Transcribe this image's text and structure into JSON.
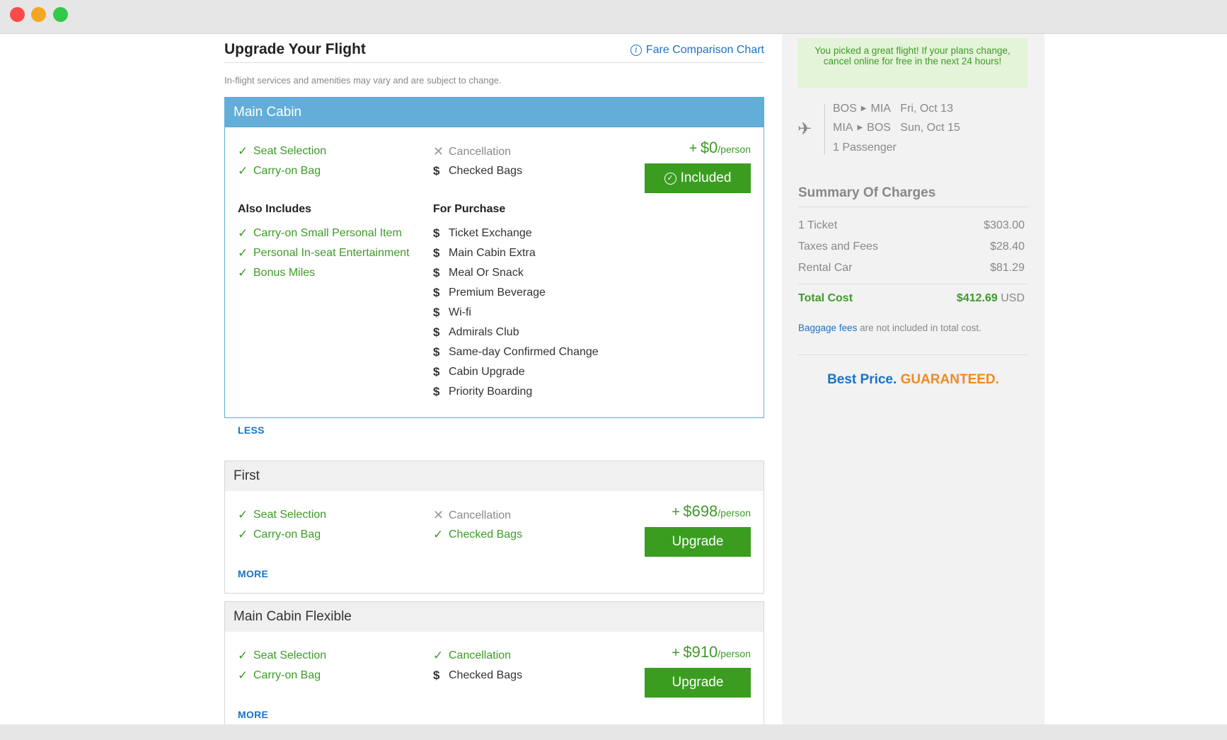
{
  "page": {
    "title": "Upgrade Your Flight",
    "fare_comparison_link": "Fare Comparison Chart",
    "subtitle": "In-flight services and amenities may vary and are subject to change."
  },
  "cards": [
    {
      "name": "Main Cabin",
      "features_left": [
        {
          "label": "Seat Selection",
          "status": "included",
          "icon": "check-icon"
        },
        {
          "label": "Carry-on Bag",
          "status": "included",
          "icon": "check-icon"
        }
      ],
      "features_right": [
        {
          "label": "Cancellation",
          "status": "unavailable",
          "icon": "x-icon"
        },
        {
          "label": "Checked Bags",
          "status": "purchase",
          "icon": "dollar-icon"
        }
      ],
      "price_plus": "+",
      "price": "$0",
      "price_unit": "/person",
      "button_label": "Included",
      "also_includes_heading": "Also Includes",
      "also_includes": [
        "Carry-on Small Personal Item",
        "Personal In-seat Entertainment",
        "Bonus Miles"
      ],
      "for_purchase_heading": "For Purchase",
      "for_purchase": [
        "Ticket Exchange",
        "Main Cabin Extra",
        "Meal Or Snack",
        "Premium Beverage",
        "Wi-fi",
        "Admirals Club",
        "Same-day Confirmed Change",
        "Cabin Upgrade",
        "Priority Boarding"
      ],
      "toggle_label": "LESS"
    },
    {
      "name": "First",
      "features_left": [
        {
          "label": "Seat Selection",
          "status": "included",
          "icon": "check-icon"
        },
        {
          "label": "Carry-on Bag",
          "status": "included",
          "icon": "check-icon"
        }
      ],
      "features_right": [
        {
          "label": "Cancellation",
          "status": "unavailable",
          "icon": "x-icon"
        },
        {
          "label": "Checked Bags",
          "status": "included",
          "icon": "check-icon"
        }
      ],
      "price_plus": "+",
      "price": "$698",
      "price_unit": "/person",
      "button_label": "Upgrade",
      "toggle_label": "MORE"
    },
    {
      "name": "Main Cabin Flexible",
      "features_left": [
        {
          "label": "Seat Selection",
          "status": "included",
          "icon": "check-icon"
        },
        {
          "label": "Carry-on Bag",
          "status": "included",
          "icon": "check-icon"
        }
      ],
      "features_right": [
        {
          "label": "Cancellation",
          "status": "included",
          "icon": "check-icon"
        },
        {
          "label": "Checked Bags",
          "status": "purchase",
          "icon": "dollar-icon"
        }
      ],
      "price_plus": "+",
      "price": "$910",
      "price_unit": "/person",
      "button_label": "Upgrade",
      "toggle_label": "MORE"
    }
  ],
  "sidebar": {
    "notice": "You picked a great flight! If your plans change, cancel online for free in the next 24 hours!",
    "itinerary": [
      {
        "from": "BOS",
        "to": "MIA",
        "date": "Fri, Oct 13"
      },
      {
        "from": "MIA",
        "to": "BOS",
        "date": "Sun, Oct 15"
      }
    ],
    "passengers": "1 Passenger",
    "summary_title": "Summary Of Charges",
    "charges": [
      {
        "label": "1 Ticket",
        "amount": "$303.00"
      },
      {
        "label": "Taxes and Fees",
        "amount": "$28.40"
      },
      {
        "label": "Rental Car",
        "amount": "$81.29"
      }
    ],
    "total_label": "Total Cost",
    "total_amount": "$412.69",
    "total_currency": "USD",
    "baggage_link": "Baggage fees",
    "baggage_note": " are not included in total cost.",
    "guarantee_best": "Best Price.",
    "guarantee_word": "GUARANTEED."
  },
  "colors": {
    "accent_green": "#3a9d20",
    "link_blue": "#1a73c9",
    "header_blue": "#62aed8",
    "notice_bg": "#e4f4d8",
    "guarantee_orange": "#f08a24"
  }
}
